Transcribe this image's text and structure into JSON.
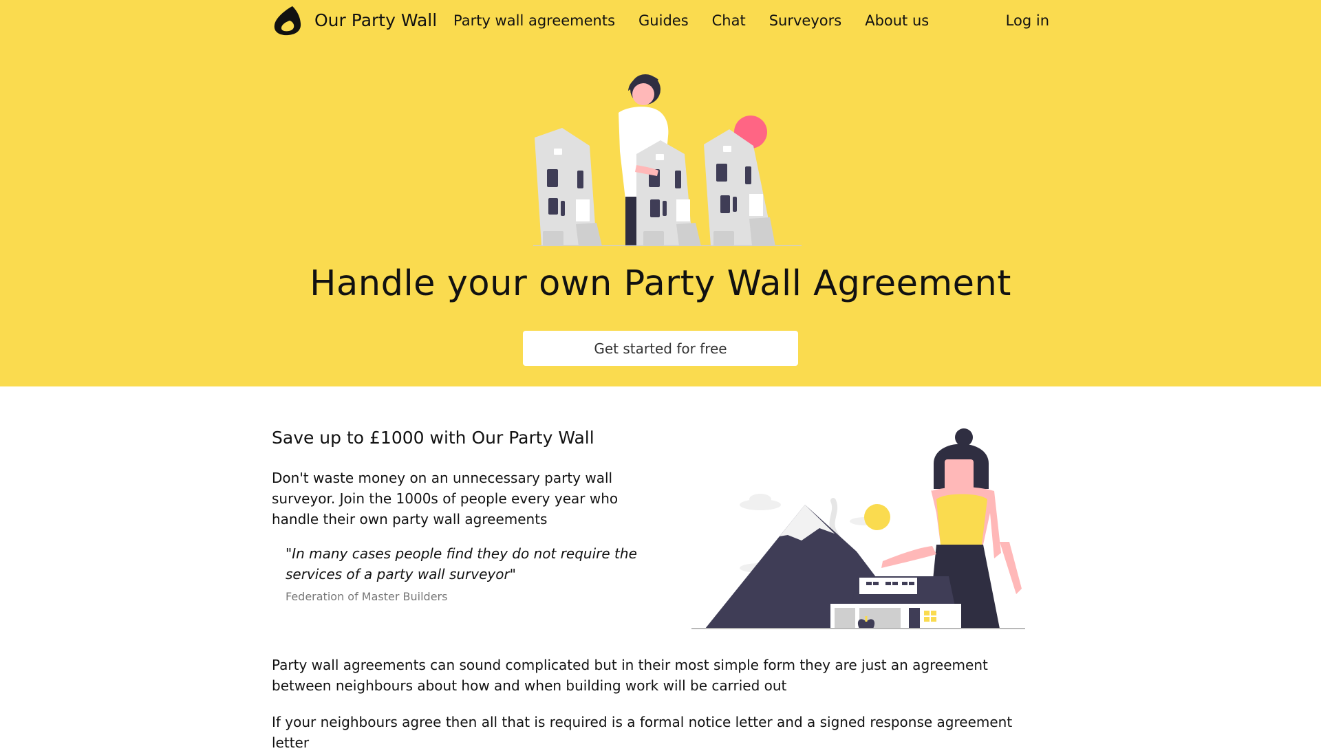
{
  "nav": {
    "brand": "Our Party Wall",
    "links": [
      "Party wall agreements",
      "Guides",
      "Chat",
      "Surveyors",
      "About us"
    ],
    "login": "Log in"
  },
  "hero": {
    "title": "Handle your own Party Wall Agreement",
    "cta": "Get started for free"
  },
  "content": {
    "section_title": "Save up to £1000 with Our Party Wall",
    "intro": "Don't waste money on an unnecessary party wall surveyor. Join the 1000s of people every year who handle their own party wall agreements",
    "quote": "\"In many cases people find they do not require the services of a party wall surveyor\"",
    "quote_source": "Federation of Master Builders",
    "paragraphs": [
      "Party wall agreements can sound complicated but in their most simple form they are just an agreement between neighbours about how and when building work will be carried out",
      "If your neighbours agree then all that is required is a formal notice letter and a signed response agreement letter"
    ]
  },
  "colors": {
    "accent": "#fadb4f",
    "dark": "#3f3d56",
    "pink": "#ff6584"
  },
  "icons": {
    "logo": "brand-logo-icon"
  }
}
